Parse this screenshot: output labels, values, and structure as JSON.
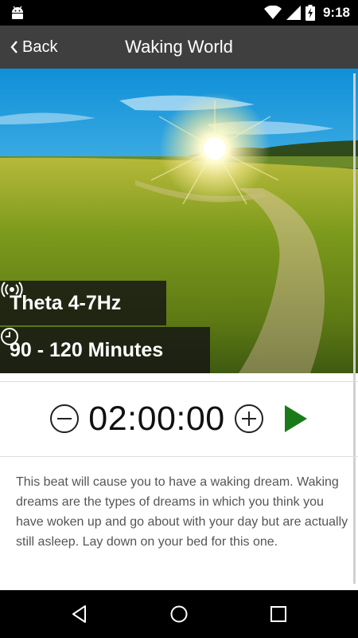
{
  "status_bar": {
    "time": "9:18",
    "icons": [
      "android-icon",
      "wifi-icon",
      "signal-icon",
      "battery-charging-icon"
    ]
  },
  "app_bar": {
    "back_label": "Back",
    "title": "Waking World"
  },
  "hero": {
    "image": "sunlit-meadow-photo",
    "frequency_label": "Theta 4-7Hz",
    "duration_label": "90 - 120 Minutes"
  },
  "timer": {
    "value": "02:00:00"
  },
  "description": "This beat will cause you to have a waking dream. Waking dreams are the types of dreams in which you think you have woken up and go about with your day but are actually still asleep. Lay down on your bed for this one.",
  "colors": {
    "app_bar": "#3f3f3f",
    "play_accent": "#1a7a1a",
    "badge_bg": "#141414"
  },
  "nav_bar": {
    "buttons": [
      "back-nav-icon",
      "home-nav-icon",
      "recents-nav-icon"
    ]
  }
}
